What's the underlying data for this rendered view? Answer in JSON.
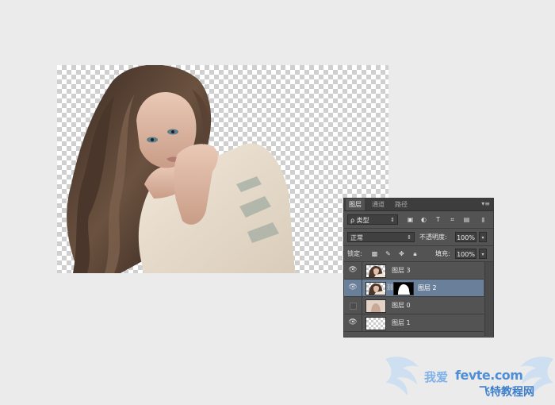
{
  "panel": {
    "tabs": [
      "图层",
      "通道",
      "路径"
    ],
    "filter_label": "ρ 类型",
    "blend_mode": "正常",
    "opacity_label": "不透明度:",
    "opacity_value": "100%",
    "lock_label": "锁定:",
    "fill_label": "填充:",
    "fill_value": "100%",
    "layers": [
      {
        "name": "图层 3",
        "visible": true,
        "selected": false
      },
      {
        "name": "图层 2",
        "visible": true,
        "selected": true
      },
      {
        "name": "图层 0",
        "visible": false,
        "selected": false
      },
      {
        "name": "图层 1",
        "visible": true,
        "selected": false
      }
    ]
  },
  "watermark": {
    "url": "fevte.com",
    "cn_left": "我爱",
    "cn_brand": "飞特教程网"
  },
  "colors": {
    "background": "#ebebeb",
    "panel": "#535353",
    "selected_layer": "#6a7f9a",
    "watermark_blue": "#4f8fd6"
  }
}
